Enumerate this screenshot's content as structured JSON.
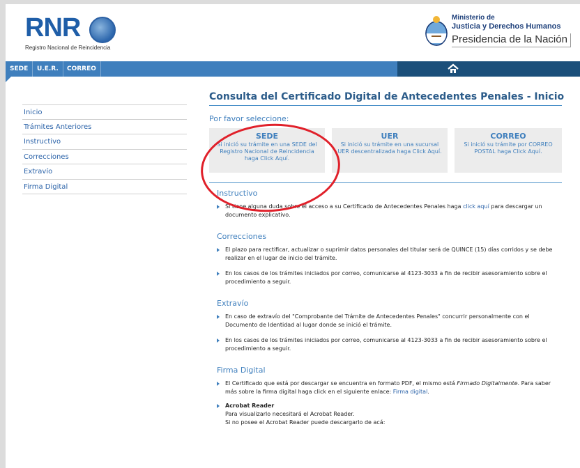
{
  "header": {
    "logo_text": "RNR",
    "logo_sub": "Registro Nacional de Reincidencia",
    "ministry_line1": "Ministerio de",
    "ministry_line2": "Justicia y Derechos Humanos",
    "ministry_line3": "Presidencia de la Nación"
  },
  "nav": {
    "items": [
      "SEDE",
      "U.E.R.",
      "CORREO"
    ]
  },
  "sidebar": {
    "items": [
      "Inicio",
      "Trámites Anteriores",
      "Instructivo",
      "Correcciones",
      "Extravío",
      "Firma Digital"
    ]
  },
  "main": {
    "title": "Consulta del Certificado Digital de Antecedentes Penales - Inicio",
    "choose": "Por favor seleccione:",
    "boxes": [
      {
        "title": "SEDE",
        "desc": "Si inició su trámite en una SEDE del Registro Nacional de Reincidencia haga Click Aquí."
      },
      {
        "title": "UER",
        "desc": "Si inició su trámite en una sucursal UER descentralizada haga Click Aquí."
      },
      {
        "title": "CORREO",
        "desc": "Si inició su trámite por CORREO POSTAL haga Click Aquí."
      }
    ],
    "sections": {
      "instructivo": {
        "title": "Instructivo",
        "b1_pre": "Si tiene alguna duda sobre el acceso a su Certificado de Antecedentes Penales haga ",
        "b1_link": "click aquí",
        "b1_post": " para descargar un documento explicativo."
      },
      "correcciones": {
        "title": "Correcciones",
        "b1": "El plazo para rectificar, actualizar o suprimir datos personales del titular será de QUINCE (15) días corridos y se debe realizar en el lugar de inicio del trámite.",
        "b2": "En los casos de los trámites iniciados por correo, comunicarse al 4123-3033 a fin de recibir asesoramiento sobre el procedimiento a seguir."
      },
      "extravio": {
        "title": "Extravío",
        "b1": "En caso de extravío del \"Comprobante del Trámite de Antecedentes Penales\" concurrir personalmente con el Documento de Identidad al lugar donde se inició el trámite.",
        "b2": "En los casos de los trámites iniciados por correo, comunicarse al 4123-3033 a fin de recibir asesoramiento sobre el procedimiento a seguir."
      },
      "firma": {
        "title": "Firma Digital",
        "b1_pre": "El Certificado que está por descargar se encuentra en formato PDF, el mismo está ",
        "b1_em": "Firmado Digitalmente",
        "b1_mid": ". Para saber más sobre la firma digital haga click en el siguiente enlace: ",
        "b1_link": "Firma digital",
        "b1_end": ".",
        "b2_title": "Acrobat Reader",
        "b2_l1": "Para visualizarlo necesitará el Acrobat Reader.",
        "b2_l2": "Si no posee el Acrobat Reader puede descargarlo de acá:"
      }
    }
  },
  "colors": {
    "nav_blue": "#3f7fbd",
    "nav_dark": "#1b4f7a",
    "annotation_red": "#e0202a"
  }
}
